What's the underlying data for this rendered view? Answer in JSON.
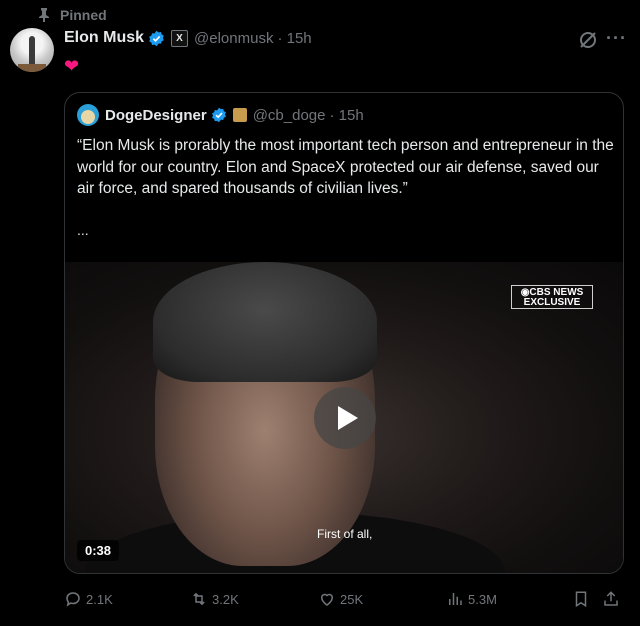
{
  "pinned": {
    "label": "Pinned"
  },
  "post": {
    "author_name": "Elon Musk",
    "author_handle": "@elonmusk",
    "timestamp": "· 15h",
    "xbadge": "X",
    "body_icon": "heart-icon"
  },
  "quote": {
    "author_name": "DogeDesigner",
    "author_handle": "@cb_doge",
    "timestamp": "· 15h",
    "text": "“Elon Musk is prorably the most important tech person and entrepreneur in the world for our country. Elon and SpaceX protected our air defense, saved our air force, and spared thousands of civilian lives.”",
    "more": "..."
  },
  "video": {
    "badge_line1": "◉CBS NEWS",
    "badge_line2": "EXCLUSIVE",
    "caption": "First of all,",
    "duration": "0:38"
  },
  "actions": {
    "replies": "2.1K",
    "reposts": "3.2K",
    "likes": "25K",
    "views": "5.3M"
  },
  "colors": {
    "accent_blue": "#1d9bf0",
    "like_pink": "#f91880",
    "muted": "#71767b"
  }
}
